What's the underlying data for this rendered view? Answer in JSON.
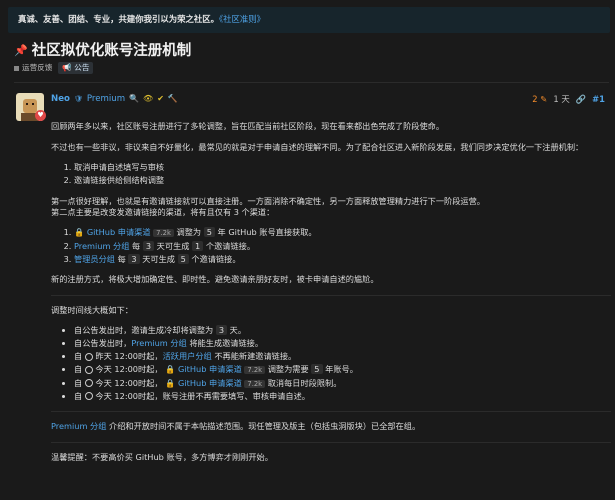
{
  "banner": {
    "text": "真诚、友善、团结、专业，共建你我引以为荣之社区。",
    "link": "《社区准则》"
  },
  "topic": {
    "title": "社区拟优化账号注册机制",
    "category": "运营反馈",
    "tag": "公告"
  },
  "post": {
    "username": "Neo",
    "user_group": "Premium",
    "edits": "2",
    "age": "1 天",
    "number": "#1",
    "p1": "回顾两年多以来，社区账号注册进行了多轮调整，旨在匹配当前社区阶段，现在看来都出色完成了阶段使命。",
    "p2": "不过也有一些非议，非议来自不好量化，最常见的就是对于申请自述的理解不同。为了配合社区进入新阶段发展，我们同步决定优化一下注册机制：",
    "list1": [
      "取消申请自述填写与审核",
      "邀请链接供给侧结构调整"
    ],
    "p3a": "第一点很好理解，也就是有邀请链接就可以直接注册。一方面消除不确定性，另一方面释放管理精力进行下一阶段运营。",
    "p3b": "第二点主要是改变发邀请链接的渠道，将有且仅有 3 个渠道：",
    "channels": [
      {
        "link": "GitHub 申请渠道",
        "count": "7.2k",
        "pre": "调整为",
        "code": "5",
        "post": "年 GitHub 账号直接获取。"
      },
      {
        "link": "Premium 分组",
        "pre": "每",
        "code": "3",
        "mid": "天可生成",
        "code2": "1",
        "post": "个邀请链接。"
      },
      {
        "link": "管理员分组",
        "pre": "每",
        "code": "3",
        "mid": "天可生成",
        "code2": "5",
        "post": "个邀请链接。"
      }
    ],
    "p4": "新的注册方式，将极大增加确定性、即时性。避免邀请亲朋好友时，被卡申请自述的尴尬。",
    "timeline_heading": "调整时间线大概如下：",
    "timeline": {
      "t1_pre": "自公告发出时，邀请生成冷却将调整为",
      "t1_code": "3",
      "t1_post": "天。",
      "t2_pre": "自公告发出时，",
      "t2_link": "Premium 分组",
      "t2_post": "将能生成邀请链接。",
      "t3_a": "自",
      "t3_day": "昨天",
      "t3_time": "12:00",
      "t3_b": "时起，",
      "t3_link": "活跃用户分组",
      "t3_c": "不再能新建邀请链接。",
      "t4_a": "自",
      "t4_day": "今天",
      "t4_time": "12:00",
      "t4_b": "时起，",
      "t4_link": "GitHub 申请渠道",
      "t4_count": "7.2k",
      "t4_c": "调整为需要",
      "t4_code": "5",
      "t4_d": "年账号。",
      "t5_a": "自",
      "t5_day": "今天",
      "t5_time": "12:00",
      "t5_b": "时起，",
      "t5_link": "GitHub 申请渠道",
      "t5_count": "7.2k",
      "t5_c": "取消每日时段限制。",
      "t6_a": "自",
      "t6_day": "今天",
      "t6_time": "12:00",
      "t6_b": "时起，账号注册不再需要填写、审核申请自述。"
    },
    "p5_link": "Premium 分组",
    "p5_text": "介绍和开放时间不属于本帖描述范围。现任管理及版主（包括虫洞版块）已全部在组。",
    "p6": "温馨提醒：不要高价买 GitHub 账号，多方博弈才刚刚开始。"
  }
}
